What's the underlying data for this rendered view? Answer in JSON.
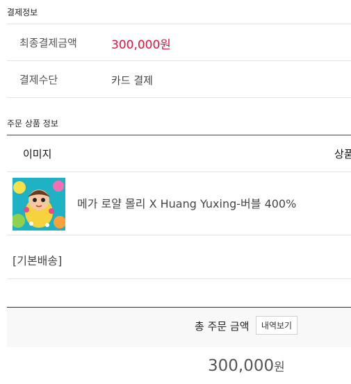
{
  "payment_info": {
    "section_title": "결제정보",
    "final_amount_label": "최종결제금액",
    "final_amount_value": "300,000원",
    "method_label": "결제수단",
    "method_value": "카드 결제"
  },
  "order_products": {
    "section_title": "주문 상품 정보",
    "columns": [
      "이미지",
      "상품"
    ],
    "items": [
      {
        "name": "메가 로얄 몰리 X Huang Yuxing-버블 400%"
      }
    ],
    "shipping_group": "[기본배송]"
  },
  "total": {
    "label": "총 주문 금액",
    "detail_button": "내역보기",
    "amount": "300,000",
    "unit": "원"
  },
  "colors": {
    "accent_red": "#e0143c",
    "divider": "#e3e3e3"
  }
}
